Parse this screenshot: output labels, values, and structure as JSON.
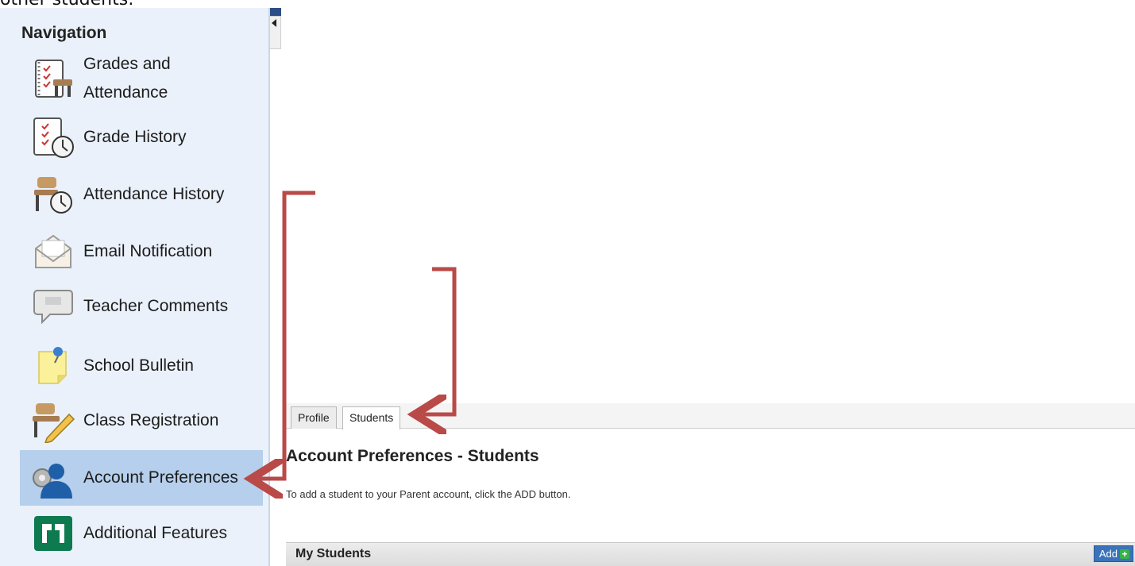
{
  "doc_fragment": "other students:",
  "nav": {
    "title": "Navigation",
    "items": [
      {
        "label": "Grades and",
        "label2": "Attendance"
      },
      {
        "label": "Grade History"
      },
      {
        "label": "Attendance History"
      },
      {
        "label": "Email Notification"
      },
      {
        "label": "Teacher Comments"
      },
      {
        "label": "School Bulletin"
      },
      {
        "label": "Class Registration"
      },
      {
        "label": "Account Preferences"
      },
      {
        "label": "Additional Features"
      }
    ]
  },
  "tabs": [
    {
      "label": "Profile"
    },
    {
      "label": "Students"
    }
  ],
  "main": {
    "title": "Account Preferences - Students",
    "description": "To add a student to your Parent account, click the ADD button."
  },
  "section": {
    "title": "My Students",
    "add_label": "Add"
  },
  "colors": {
    "sidebar_bg": "#eaf1fa",
    "active_item": "#b5cfec",
    "annotation": "#b94a48",
    "add_button": "#3a73b9"
  }
}
